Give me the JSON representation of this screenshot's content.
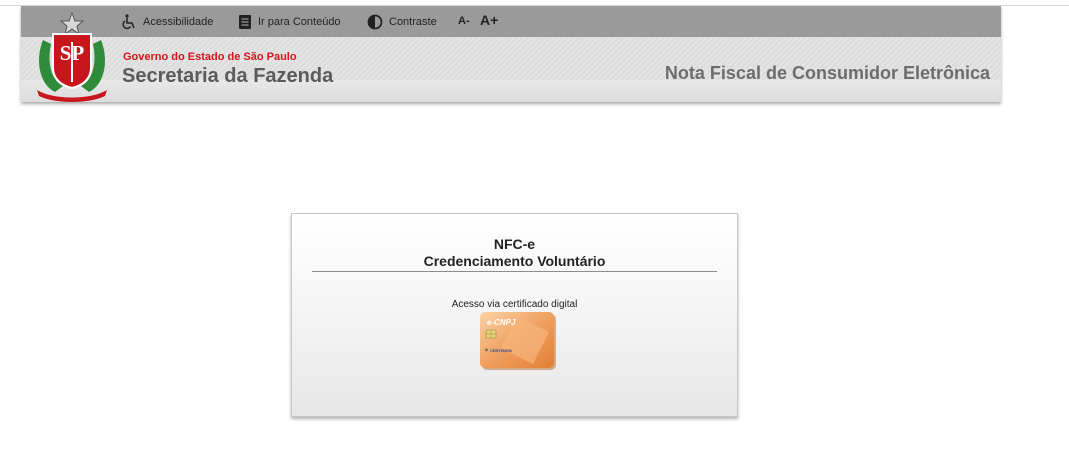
{
  "accessibility_bar": {
    "items": [
      {
        "label": "Acessibilidade",
        "icon": "wheelchair-icon"
      },
      {
        "label": "Ir para Conteúdo",
        "icon": "document-icon"
      },
      {
        "label": "Contraste",
        "icon": "contrast-icon"
      }
    ],
    "font_decrease": "A-",
    "font_increase": "A+"
  },
  "header": {
    "logo_icon": "sp-coat-of-arms-icon",
    "government": "Governo do Estado de São Paulo",
    "secretariat": "Secretaria da Fazenda",
    "system_title": "Nota Fiscal de Consumidor Eletrônica"
  },
  "card": {
    "title_line1": "NFC-e",
    "title_line2": "Credenciamento Voluntário",
    "access_label": "Acesso via certificado digital",
    "certificate_icon": "ecnpj-certificate-card-icon"
  },
  "colors": {
    "accent_red": "#d4161b",
    "header_gray": "#9a9a9a",
    "card_orange": "#f0a060"
  }
}
